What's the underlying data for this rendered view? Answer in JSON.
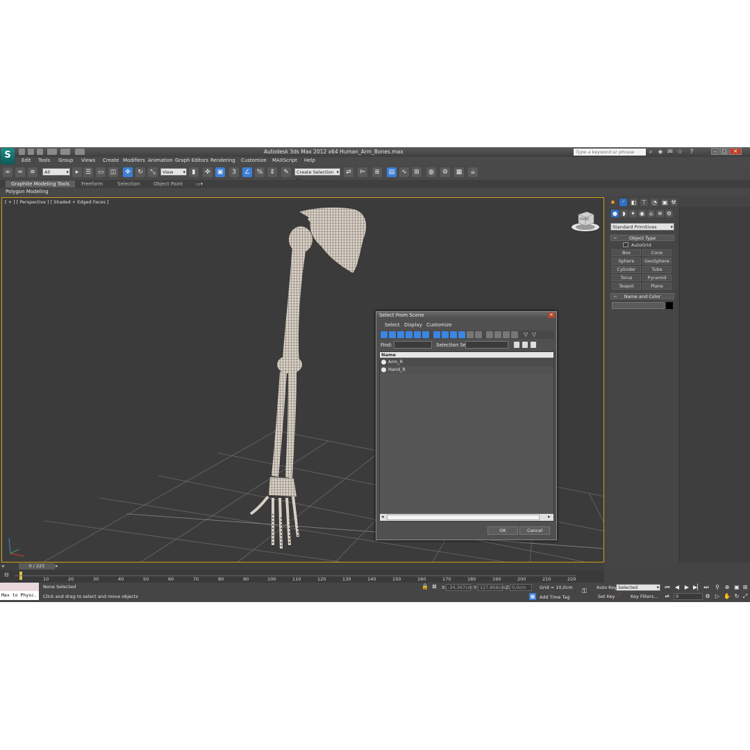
{
  "title_bar": {
    "app_title": "Autodesk 3ds Max  2012 x64     Human_Arm_Bones.max",
    "search_placeholder": "Type a keyword or phrase"
  },
  "menu": [
    "Edit",
    "Tools",
    "Group",
    "Views",
    "Create",
    "Modifiers",
    "Animation",
    "Graph Editors",
    "Rendering",
    "Customize",
    "MAXScript",
    "Help"
  ],
  "toolbar": {
    "selection_filter": "All",
    "reference_coord": "View",
    "named_selection": "Create Selection Se"
  },
  "ribbon": {
    "tabs": [
      "Graphite Modeling Tools",
      "Freeform",
      "Selection",
      "Object Paint"
    ],
    "active_tab": "Graphite Modeling Tools",
    "sub_label": "Polygon Modeling"
  },
  "viewport": {
    "label": "[ + ] [ Perspective ] [ Shaded + Edged Faces ]",
    "cube_label": "FRONT"
  },
  "command_panel": {
    "dropdown": "Standard Primitives",
    "object_type_title": "Object Type",
    "autogrid": "AutoGrid",
    "buttons": [
      "Box",
      "Cone",
      "Sphere",
      "GeoSphere",
      "Cylinder",
      "Tube",
      "Torus",
      "Pyramid",
      "Teapot",
      "Plane"
    ],
    "name_color_title": "Name and Color",
    "color_swatch": "#000000"
  },
  "dialog": {
    "title": "Select From Scene",
    "menu": [
      "Select",
      "Display",
      "Customize"
    ],
    "find_label": "Find:",
    "selection_set_label": "Selection Set:",
    "column_header": "Name",
    "items": [
      "Arm_R",
      "Hand_R"
    ],
    "ok": "OK",
    "cancel": "Cancel"
  },
  "timeline": {
    "frame_indicator": "0 / 225",
    "ticks": [
      "10",
      "20",
      "30",
      "40",
      "50",
      "60",
      "70",
      "80",
      "90",
      "100",
      "110",
      "120",
      "130",
      "140",
      "150",
      "160",
      "170",
      "180",
      "190",
      "200",
      "210",
      "220"
    ]
  },
  "status": {
    "maxscript": "Max to Physc.",
    "selection": "None Selected",
    "prompt": "Click and drag to select and move objects",
    "x": "-34,367cm",
    "y": "127,856cm",
    "z": "0,0cm",
    "x_label": "X:",
    "y_label": "Y:",
    "z_label": "Z:",
    "grid": "Grid = 10,0cm",
    "add_time_tag": "Add Time Tag",
    "auto_key": "Auto Key",
    "set_key": "Set Key",
    "key_mode": "Selected",
    "key_filters": "Key Filters...",
    "current_frame": "0"
  },
  "colors": {
    "accent": "#3d7fd6",
    "viewport_border": "#d4a017",
    "bone": "#d8cfc4"
  }
}
